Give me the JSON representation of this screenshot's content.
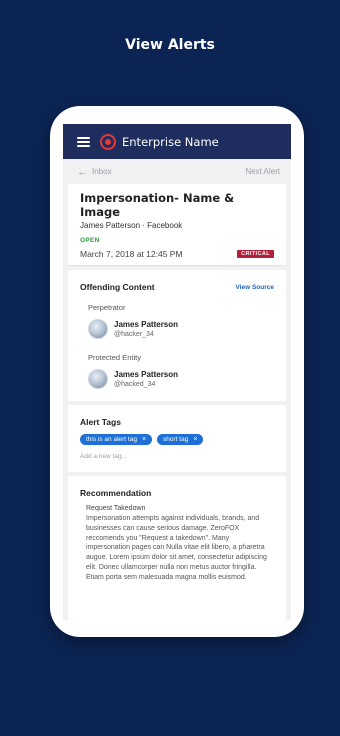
{
  "page": {
    "heading": "View Alerts"
  },
  "app": {
    "enterprise_name": "Enterprise Name"
  },
  "nav": {
    "back_label": "Inbox",
    "next_label": "Next Alert"
  },
  "alert": {
    "title": "Impersonation- Name & Image",
    "subtitle": "James Patterson · Facebook",
    "status": "OPEN",
    "date": "March 7, 2018 at 12:45 PM",
    "severity": "CRITICAL"
  },
  "offending": {
    "title": "Offending Content",
    "view_source": "View Source",
    "perpetrator_label": "Perpetrator",
    "perpetrator": {
      "name": "James Patterson",
      "handle": "@hacker_34"
    },
    "protected_label": "Protected Entity",
    "protected": {
      "name": "James Patterson",
      "handle": "@hacked_34"
    }
  },
  "tags": {
    "title": "Alert Tags",
    "items": [
      {
        "label": "this is an alert tag"
      },
      {
        "label": "short tag"
      }
    ],
    "remove_glyph": "×",
    "add_placeholder": "Add a new tag..."
  },
  "recommendation": {
    "title": "Recommendation",
    "subtitle": "Request Takedown",
    "body": "Impersonation attempts against individuals, brands, and businesses can cause serious damage. ZeroFOX reccomends you \"Request a takedown\". Many impersonation pages can Nulla vitae elit libero, a pharetra augue. Lorem ipsum dolor sit amet, consectetur adipiscing elit. Donec ullamcorper nulla non metus auctor fringilla. Etiam porta sem malesuada magna mollis euismod."
  },
  "colors": {
    "background": "#0c2453",
    "topbar": "#1e2d5e",
    "accent": "#1e6fd6",
    "critical": "#b3203a",
    "open": "#2e9d3d"
  }
}
